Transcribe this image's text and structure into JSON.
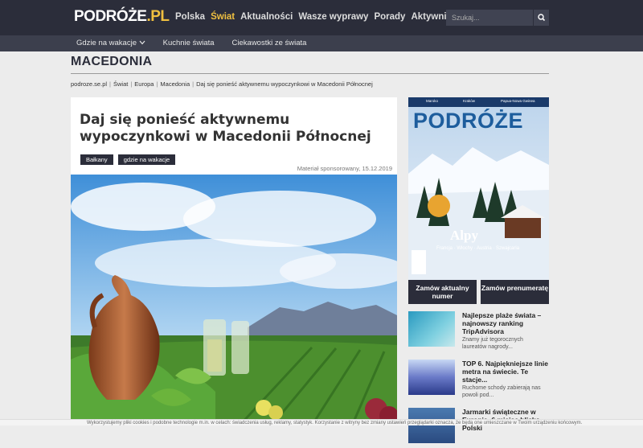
{
  "header": {
    "logo_main": "PODRÓŻE",
    "logo_suffix": ".PL",
    "nav": [
      "Polska",
      "Świat",
      "Aktualności",
      "Wasze wyprawy",
      "Porady",
      "Aktywnie"
    ],
    "active_nav": "Świat",
    "search_placeholder": "Szukaj...",
    "colors": {
      "bar": "#2b2d3a",
      "accent": "#f0c040"
    }
  },
  "subnav": {
    "items": [
      "Gdzie na wakacje",
      "Kuchnie świata",
      "Ciekawostki ze świata"
    ]
  },
  "page": {
    "section_title": "MACEDONIA",
    "breadcrumb": [
      "podroze.se.pl",
      "Świat",
      "Europa",
      "Macedonia",
      "Daj się ponieść aktywnemu wypoczynkowi w Macedonii Północnej"
    ]
  },
  "article": {
    "headline": "Daj się ponieść aktywnemu wypoczynkowi w Macedonii Północnej",
    "tags": [
      "Bałkany",
      "gdzie na wakacje"
    ],
    "meta": "Materiał sponsorowany, 15.12.2019"
  },
  "sidebar": {
    "cover": {
      "top_labels": [
        "Maroko",
        "Kraków",
        "Papua-Nowa Gwinea"
      ],
      "logo": "PODRÓŻE",
      "headline": "Alpy",
      "subline": "Francja · Włochy · Austria · Szwajcaria"
    },
    "buttons": [
      "Zamów aktualny numer",
      "Zamów prenumeratę"
    ],
    "items": [
      {
        "title": "Najlepsze plaże świata – najnowszy ranking TripAdvisora",
        "desc": "Znamy już tegorocznych laureatów nagrody..."
      },
      {
        "title": "TOP 6. Najpiękniejsze linie metra na świecie. Te stacje...",
        "desc": "Ruchome schody zabierają nas powoli pod..."
      },
      {
        "title": "Jarmarki świąteczne w Europie. 6 miejsc blisko Polski",
        "desc": ""
      }
    ]
  },
  "cookie_bar": {
    "text": "Wykorzystujemy pliki cookies i podobne technologie m.in. w celach: świadczenia usług, reklamy, statystyk. Korzystanie z witryny bez zmiany ustawień przeglądarki oznacza, że będą one umieszczane w Twoim urządzeniu końcowym."
  }
}
